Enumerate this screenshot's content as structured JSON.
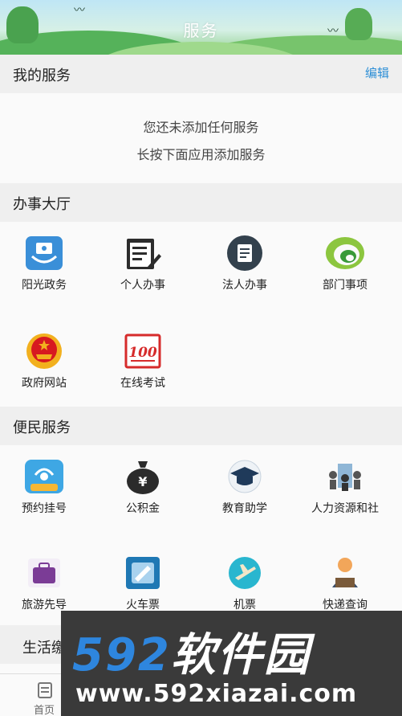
{
  "header": {
    "title": "服务"
  },
  "my_services": {
    "title": "我的服务",
    "edit_label": "编辑",
    "empty_line1": "您还未添加任何服务",
    "empty_line2": "长按下面应用添加服务"
  },
  "hall": {
    "title": "办事大厅",
    "items": [
      {
        "label": "阳光政务",
        "icon": "sunshine-gov-icon"
      },
      {
        "label": "个人办事",
        "icon": "notepad-pen-icon"
      },
      {
        "label": "法人办事",
        "icon": "document-circle-icon"
      },
      {
        "label": "部门事项",
        "icon": "green-swirl-icon"
      },
      {
        "label": "政府网站",
        "icon": "national-emblem-icon"
      },
      {
        "label": "在线考试",
        "icon": "score-100-icon"
      }
    ]
  },
  "convenience": {
    "title": "便民服务",
    "items": [
      {
        "label": "预约挂号",
        "icon": "appointment-icon",
        "badge": "预约挂号"
      },
      {
        "label": "公积金",
        "icon": "money-bag-icon",
        "symbol": "¥"
      },
      {
        "label": "教育助学",
        "icon": "graduation-cap-icon"
      },
      {
        "label": "人力资源和社",
        "icon": "people-building-icon"
      },
      {
        "label": "旅游先导",
        "icon": "suitcase-icon"
      },
      {
        "label": "火车票",
        "icon": "train-ticket-icon"
      },
      {
        "label": "机票",
        "icon": "airplane-icon"
      },
      {
        "label": "快递查询",
        "icon": "courier-icon"
      }
    ]
  },
  "life": {
    "title": "生活缴"
  },
  "bottom_nav": {
    "home_label": "首页"
  },
  "watermark": {
    "num": "592",
    "cn": "软件园",
    "url": "www.592xiazai.com"
  },
  "colors": {
    "accent": "#2e8fd6",
    "section_bg": "#efefef",
    "page_bg": "#fafafa"
  }
}
